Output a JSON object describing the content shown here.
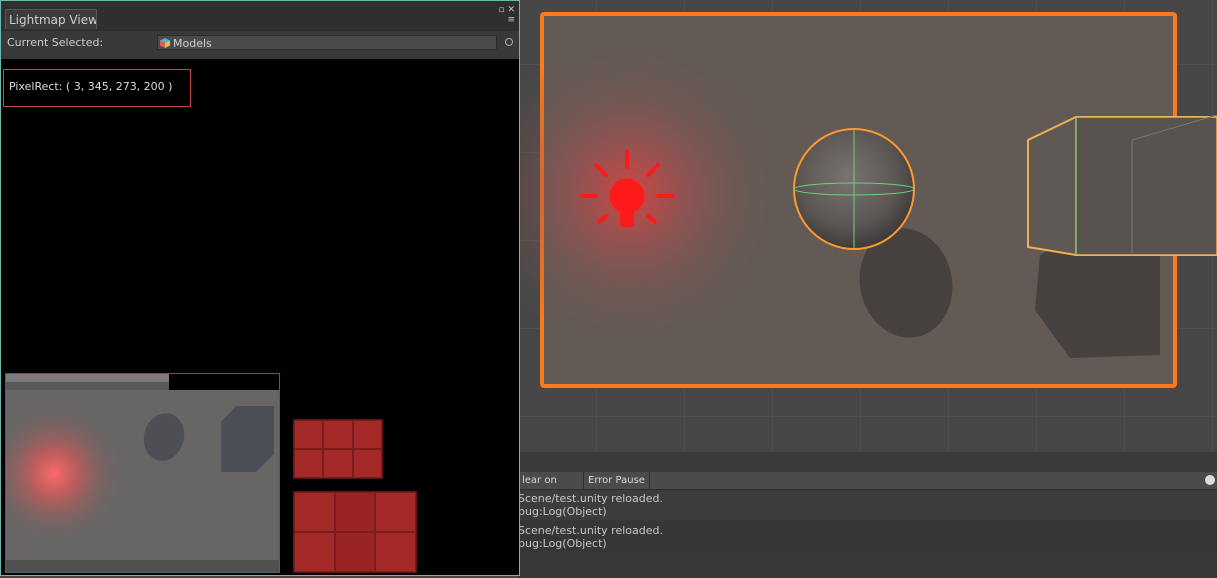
{
  "lightmap_window": {
    "tab_title": "Lightmap Viewe",
    "current_selected_label": "Current Selected:",
    "current_selected_value": "Models",
    "pixel_rect": "PixelRect: ( 3, 345, 273, 200 )"
  },
  "console": {
    "toolbar": {
      "clear_on_play": "lear on Play",
      "error_pause": "Error Pause"
    },
    "logs": [
      {
        "line1": "Scene/test.unity reloaded.",
        "line2": "bug:Log(Object)"
      },
      {
        "line1": "Scene/test.unity reloaded.",
        "line2": "bug:Log(Object)"
      }
    ]
  },
  "colors": {
    "selection_outline": "#ff7a1a",
    "light_icon": "#ff0000",
    "window_border": "#6fb6b2",
    "pixel_rect_border": "#c6444e"
  }
}
